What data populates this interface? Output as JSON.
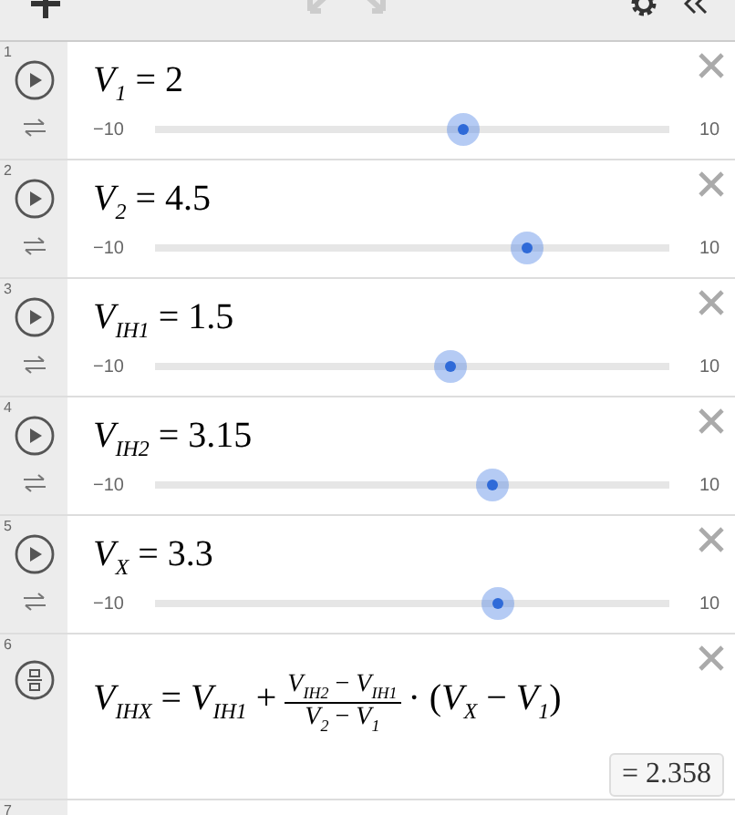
{
  "toolbar": {
    "undo_disabled": true,
    "redo_disabled": true
  },
  "expressions": [
    {
      "kind": "slider",
      "number": "1",
      "latex": "*V*$_{1}$ = 2",
      "min": "−10",
      "max": "10",
      "level": 0.6
    },
    {
      "kind": "slider",
      "number": "2",
      "latex": "*V*$_{2}$ = 4.5",
      "min": "−10",
      "max": "10",
      "level": 0.725
    },
    {
      "kind": "slider",
      "number": "3",
      "latex": "*V*$_{IH1}$ = 1.5",
      "min": "−10",
      "max": "10",
      "level": 0.575
    },
    {
      "kind": "slider",
      "number": "4",
      "latex": "*V*$_{IH2}$ = 3.15",
      "min": "−10",
      "max": "10",
      "level": 0.6575
    },
    {
      "kind": "slider",
      "number": "5",
      "latex": "*V*$_{X}$ = 3.3",
      "min": "−10",
      "max": "10",
      "level": 0.665
    },
    {
      "kind": "formula",
      "number": "6",
      "lhs": "*V*$_{IHX}$ = *V*$_{IH1}$ +",
      "numerator": "*V*$_{IH2}$ − *V*$_{IH1}$",
      "denominator": "*V*$_{2}$ − *V*$_{1}$",
      "rhs": "· (*V*$_{X}$ − *V*$_{1}$)",
      "result": "= 2.358"
    },
    {
      "kind": "empty",
      "number": "7"
    }
  ]
}
